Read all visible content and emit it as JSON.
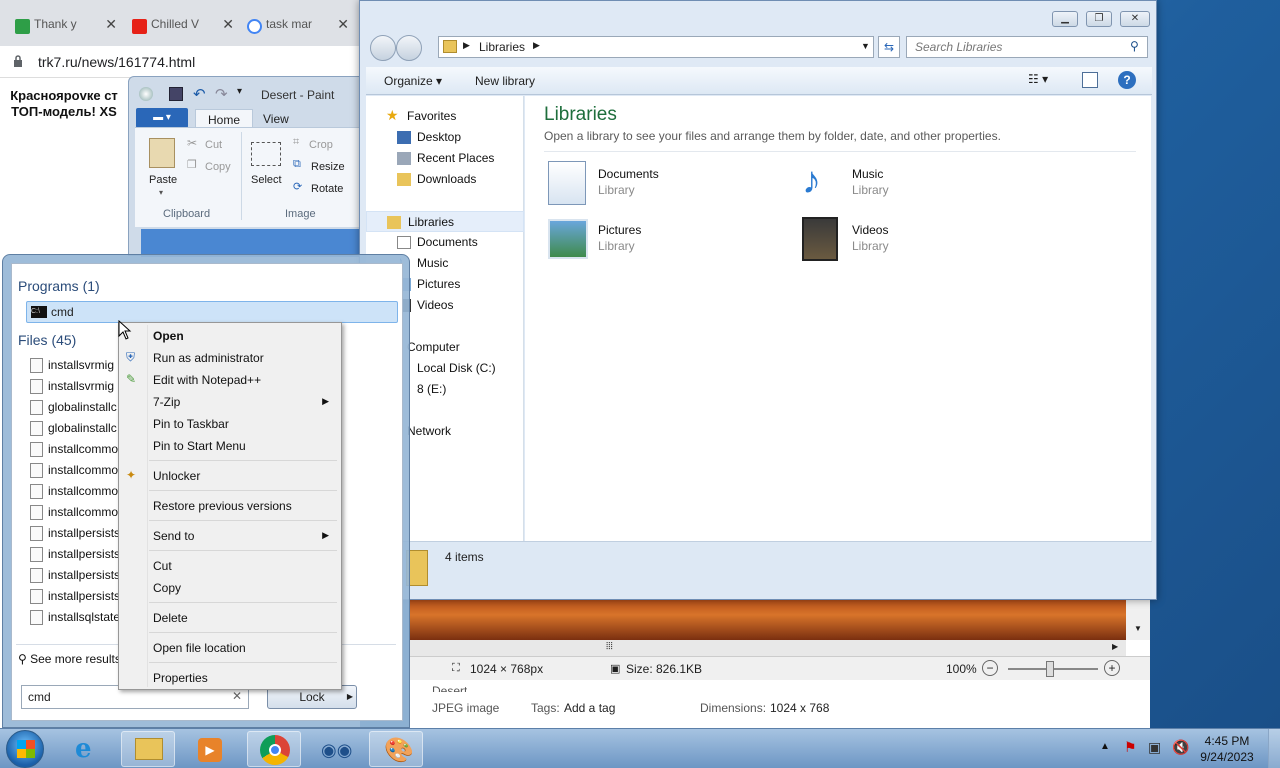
{
  "chrome": {
    "tabs": [
      {
        "label": "Thank y",
        "color": "#2e9e47"
      },
      {
        "label": "Chilled V",
        "color": "#e62117"
      },
      {
        "label": "task mar",
        "color": "#4285f4"
      }
    ],
    "url": "trk7.ru/news/161774.html",
    "headline": "Красноярovке ст ТОП-модель! XS"
  },
  "paint": {
    "title": "Desert - Paint",
    "tabs": [
      "Home",
      "View"
    ],
    "clipboard": {
      "paste": "Paste",
      "cut": "Cut",
      "copy": "Copy",
      "group": "Clipboard"
    },
    "image": {
      "select": "Select",
      "crop": "Crop",
      "resize": "Resize",
      "rotate": "Rotate",
      "group": "Image"
    },
    "status": {
      "dimensions": "1024 × 768px",
      "size": "Size: 826.1KB",
      "zoom": "100%"
    },
    "details": {
      "name": "Desert",
      "type": "JPEG image",
      "tags_label": "Tags:",
      "tags_value": "Add a tag",
      "dims_label": "Dimensions:",
      "dims_value": "1024 x 768"
    }
  },
  "explorer": {
    "address": "Libraries",
    "search_placeholder": "Search Libraries",
    "organize": "Organize",
    "new_library": "New library",
    "nav": {
      "favorites": "Favorites",
      "desktop": "Desktop",
      "recent": "Recent Places",
      "downloads": "Downloads",
      "libraries": "Libraries",
      "documents": "Documents",
      "music": "Music",
      "pictures": "Pictures",
      "videos": "Videos",
      "computer": "Computer",
      "localdisk": "Local Disk (C:)",
      "drive_e": "8 (E:)",
      "network": "Network"
    },
    "title": "Libraries",
    "subtitle": "Open a library to see your files and arrange them by folder, date, and other properties.",
    "libraries": [
      {
        "name": "Documents",
        "type": "Library"
      },
      {
        "name": "Music",
        "type": "Library"
      },
      {
        "name": "Pictures",
        "type": "Library"
      },
      {
        "name": "Videos",
        "type": "Library"
      }
    ],
    "items_count": "4 items"
  },
  "start_menu": {
    "programs_header": "Programs (1)",
    "program": "cmd",
    "files_header": "Files (45)",
    "files": [
      "installsvrmig",
      "installsvrmig",
      "globalinstallc",
      "globalinstallc",
      "installcommo",
      "installcommo",
      "installcommo",
      "installcommo",
      "installpersists",
      "installpersists",
      "installpersists",
      "installpersists",
      "installsqlstate"
    ],
    "see_more": "See more results",
    "search_value": "cmd",
    "lock_label": "Lock"
  },
  "context_menu": {
    "open": "Open",
    "run_admin": "Run as administrator",
    "edit_notepad": "Edit with Notepad++",
    "zip": "7-Zip",
    "pin_taskbar": "Pin to Taskbar",
    "pin_start": "Pin to Start Menu",
    "unlocker": "Unlocker",
    "restore": "Restore previous versions",
    "send_to": "Send to",
    "cut": "Cut",
    "copy": "Copy",
    "delete": "Delete",
    "open_location": "Open file location",
    "properties": "Properties"
  },
  "taskbar": {
    "time": "4:45 PM",
    "date": "9/24/2023"
  }
}
